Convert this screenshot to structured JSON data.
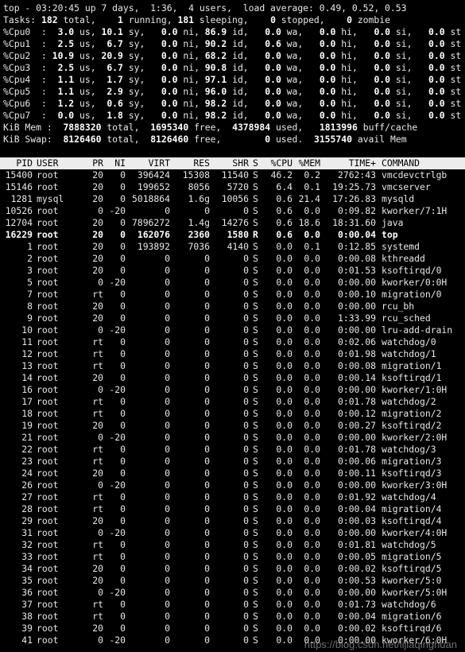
{
  "summary": {
    "uptime": "top - 03:20:45 up 7 days,  1:36,  4 users,  load average: 0.49, 0.52, 0.53",
    "tasks": {
      "total": "182",
      "running": "1",
      "sleeping": "181",
      "stopped": "0",
      "zombie": "0"
    },
    "cpus": [
      {
        "label": "%Cpu0  :",
        "us": "3.0",
        "sy": "10.1",
        "ni": "0.0",
        "id": "86.9",
        "wa": "0.0",
        "hi": "0.0",
        "si": "0.0",
        "st": "0.0"
      },
      {
        "label": "%Cpu1  :",
        "us": "2.5",
        "sy": "6.7",
        "ni": "0.0",
        "id": "90.2",
        "wa": "0.6",
        "hi": "0.0",
        "si": "0.0",
        "st": "0.0"
      },
      {
        "label": "%Cpu2  :",
        "us": "10.9",
        "sy": "20.9",
        "ni": "0.0",
        "id": "68.2",
        "wa": "0.0",
        "hi": "0.0",
        "si": "0.0",
        "st": "0.0"
      },
      {
        "label": "%Cpu3  :",
        "us": "2.5",
        "sy": "6.7",
        "ni": "0.0",
        "id": "90.8",
        "wa": "0.0",
        "hi": "0.0",
        "si": "0.0",
        "st": "0.0"
      },
      {
        "label": "%Cpu4  :",
        "us": "1.1",
        "sy": "1.7",
        "ni": "0.0",
        "id": "97.1",
        "wa": "0.0",
        "hi": "0.0",
        "si": "0.0",
        "st": "0.0"
      },
      {
        "label": "%Cpu5  :",
        "us": "1.1",
        "sy": "2.9",
        "ni": "0.0",
        "id": "96.0",
        "wa": "0.0",
        "hi": "0.0",
        "si": "0.0",
        "st": "0.0"
      },
      {
        "label": "%Cpu6  :",
        "us": "1.2",
        "sy": "0.6",
        "ni": "0.0",
        "id": "98.2",
        "wa": "0.0",
        "hi": "0.0",
        "si": "0.0",
        "st": "0.0"
      },
      {
        "label": "%Cpu7  :",
        "us": "0.0",
        "sy": "1.8",
        "ni": "0.0",
        "id": "98.2",
        "wa": "0.0",
        "hi": "0.0",
        "si": "0.0",
        "st": "0.0"
      }
    ],
    "mem": {
      "label": "KiB Mem :",
      "total": "7888320",
      "free": "1695340",
      "used": "4378984",
      "buff_cache": "1813996"
    },
    "swap": {
      "label": "KiB Swap:",
      "total": "8126460",
      "free": "8126460",
      "used": "0",
      "avail_mem": "3155740"
    }
  },
  "table": {
    "headers": [
      "PID",
      "USER",
      "PR",
      "NI",
      "VIRT",
      "RES",
      "SHR",
      "S",
      "%CPU",
      "%MEM",
      "TIME+",
      "COMMAND"
    ],
    "rows": [
      [
        "15400",
        "root",
        "20",
        "0",
        "396424",
        "15308",
        "11540",
        "S",
        "46.2",
        "0.2",
        "2762:43",
        "vmcdevctrlgb"
      ],
      [
        "15146",
        "root",
        "20",
        "0",
        "199652",
        "8056",
        "5720",
        "S",
        "6.4",
        "0.1",
        "19:25.73",
        "vmcserver"
      ],
      [
        "1281",
        "mysql",
        "20",
        "0",
        "5018864",
        "1.6g",
        "10056",
        "S",
        "0.6",
        "21.4",
        "17:26.83",
        "mysqld"
      ],
      [
        "10526",
        "root",
        "0",
        "-20",
        "0",
        "0",
        "0",
        "S",
        "0.6",
        "0.0",
        "0:09.82",
        "kworker/7:1H"
      ],
      [
        "12704",
        "root",
        "20",
        "0",
        "7896272",
        "1.4g",
        "14276",
        "S",
        "0.6",
        "18.6",
        "18:31.60",
        "java"
      ],
      [
        "16229",
        "root",
        "20",
        "0",
        "162076",
        "2360",
        "1580",
        "R",
        "0.6",
        "0.0",
        "0:00.04",
        "top"
      ],
      [
        "1",
        "root",
        "20",
        "0",
        "193892",
        "7036",
        "4140",
        "S",
        "0.0",
        "0.1",
        "0:12.85",
        "systemd"
      ],
      [
        "2",
        "root",
        "20",
        "0",
        "0",
        "0",
        "0",
        "S",
        "0.0",
        "0.0",
        "0:00.08",
        "kthreadd"
      ],
      [
        "3",
        "root",
        "20",
        "0",
        "0",
        "0",
        "0",
        "S",
        "0.0",
        "0.0",
        "0:01.53",
        "ksoftirqd/0"
      ],
      [
        "5",
        "root",
        "0",
        "-20",
        "0",
        "0",
        "0",
        "S",
        "0.0",
        "0.0",
        "0:00.00",
        "kworker/0:0H"
      ],
      [
        "7",
        "root",
        "rt",
        "0",
        "0",
        "0",
        "0",
        "S",
        "0.0",
        "0.0",
        "0:00.10",
        "migration/0"
      ],
      [
        "8",
        "root",
        "20",
        "0",
        "0",
        "0",
        "0",
        "S",
        "0.0",
        "0.0",
        "0:00.00",
        "rcu_bh"
      ],
      [
        "9",
        "root",
        "20",
        "0",
        "0",
        "0",
        "0",
        "S",
        "0.0",
        "0.0",
        "1:33.99",
        "rcu_sched"
      ],
      [
        "10",
        "root",
        "0",
        "-20",
        "0",
        "0",
        "0",
        "S",
        "0.0",
        "0.0",
        "0:00.00",
        "lru-add-drain"
      ],
      [
        "11",
        "root",
        "rt",
        "0",
        "0",
        "0",
        "0",
        "S",
        "0.0",
        "0.0",
        "0:02.06",
        "watchdog/0"
      ],
      [
        "12",
        "root",
        "rt",
        "0",
        "0",
        "0",
        "0",
        "S",
        "0.0",
        "0.0",
        "0:01.98",
        "watchdog/1"
      ],
      [
        "13",
        "root",
        "rt",
        "0",
        "0",
        "0",
        "0",
        "S",
        "0.0",
        "0.0",
        "0:00.08",
        "migration/1"
      ],
      [
        "14",
        "root",
        "20",
        "0",
        "0",
        "0",
        "0",
        "S",
        "0.0",
        "0.0",
        "0:00.14",
        "ksoftirqd/1"
      ],
      [
        "16",
        "root",
        "0",
        "-20",
        "0",
        "0",
        "0",
        "S",
        "0.0",
        "0.0",
        "0:00.00",
        "kworker/1:0H"
      ],
      [
        "17",
        "root",
        "rt",
        "0",
        "0",
        "0",
        "0",
        "S",
        "0.0",
        "0.0",
        "0:01.78",
        "watchdog/2"
      ],
      [
        "18",
        "root",
        "rt",
        "0",
        "0",
        "0",
        "0",
        "S",
        "0.0",
        "0.0",
        "0:00.12",
        "migration/2"
      ],
      [
        "19",
        "root",
        "20",
        "0",
        "0",
        "0",
        "0",
        "S",
        "0.0",
        "0.0",
        "0:00.27",
        "ksoftirqd/2"
      ],
      [
        "21",
        "root",
        "0",
        "-20",
        "0",
        "0",
        "0",
        "S",
        "0.0",
        "0.0",
        "0:00.00",
        "kworker/2:0H"
      ],
      [
        "22",
        "root",
        "rt",
        "0",
        "0",
        "0",
        "0",
        "S",
        "0.0",
        "0.0",
        "0:01.78",
        "watchdog/3"
      ],
      [
        "23",
        "root",
        "rt",
        "0",
        "0",
        "0",
        "0",
        "S",
        "0.0",
        "0.0",
        "0:00.06",
        "migration/3"
      ],
      [
        "24",
        "root",
        "20",
        "0",
        "0",
        "0",
        "0",
        "S",
        "0.0",
        "0.0",
        "0:00.11",
        "ksoftirqd/3"
      ],
      [
        "26",
        "root",
        "0",
        "-20",
        "0",
        "0",
        "0",
        "S",
        "0.0",
        "0.0",
        "0:00.00",
        "kworker/3:0H"
      ],
      [
        "27",
        "root",
        "rt",
        "0",
        "0",
        "0",
        "0",
        "S",
        "0.0",
        "0.0",
        "0:01.92",
        "watchdog/4"
      ],
      [
        "28",
        "root",
        "rt",
        "0",
        "0",
        "0",
        "0",
        "S",
        "0.0",
        "0.0",
        "0:00.04",
        "migration/4"
      ],
      [
        "29",
        "root",
        "20",
        "0",
        "0",
        "0",
        "0",
        "S",
        "0.0",
        "0.0",
        "0:00.03",
        "ksoftirqd/4"
      ],
      [
        "31",
        "root",
        "0",
        "-20",
        "0",
        "0",
        "0",
        "S",
        "0.0",
        "0.0",
        "0:00.00",
        "kworker/4:0H"
      ],
      [
        "32",
        "root",
        "rt",
        "0",
        "0",
        "0",
        "0",
        "S",
        "0.0",
        "0.0",
        "0:01.81",
        "watchdog/5"
      ],
      [
        "33",
        "root",
        "rt",
        "0",
        "0",
        "0",
        "0",
        "S",
        "0.0",
        "0.0",
        "0:00.05",
        "migration/5"
      ],
      [
        "34",
        "root",
        "20",
        "0",
        "0",
        "0",
        "0",
        "S",
        "0.0",
        "0.0",
        "0:00.02",
        "ksoftirqd/5"
      ],
      [
        "35",
        "root",
        "20",
        "0",
        "0",
        "0",
        "0",
        "S",
        "0.0",
        "0.0",
        "0:00.53",
        "kworker/5:0"
      ],
      [
        "36",
        "root",
        "0",
        "-20",
        "0",
        "0",
        "0",
        "S",
        "0.0",
        "0.0",
        "0:00.00",
        "kworker/5:0H"
      ],
      [
        "37",
        "root",
        "rt",
        "0",
        "0",
        "0",
        "0",
        "S",
        "0.0",
        "0.0",
        "0:01.73",
        "watchdog/6"
      ],
      [
        "38",
        "root",
        "rt",
        "0",
        "0",
        "0",
        "0",
        "S",
        "0.0",
        "0.0",
        "0:00.04",
        "migration/6"
      ],
      [
        "39",
        "root",
        "20",
        "0",
        "0",
        "0",
        "0",
        "S",
        "0.0",
        "0.0",
        "0:00.02",
        "ksoftirqd/6"
      ],
      [
        "41",
        "root",
        "0",
        "-20",
        "0",
        "0",
        "0",
        "S",
        "0.0",
        "0.0",
        "0:00.00",
        "kworker/6:0H"
      ]
    ]
  },
  "watermark": "https://blog.csdn.net/lijiaqinghuan"
}
